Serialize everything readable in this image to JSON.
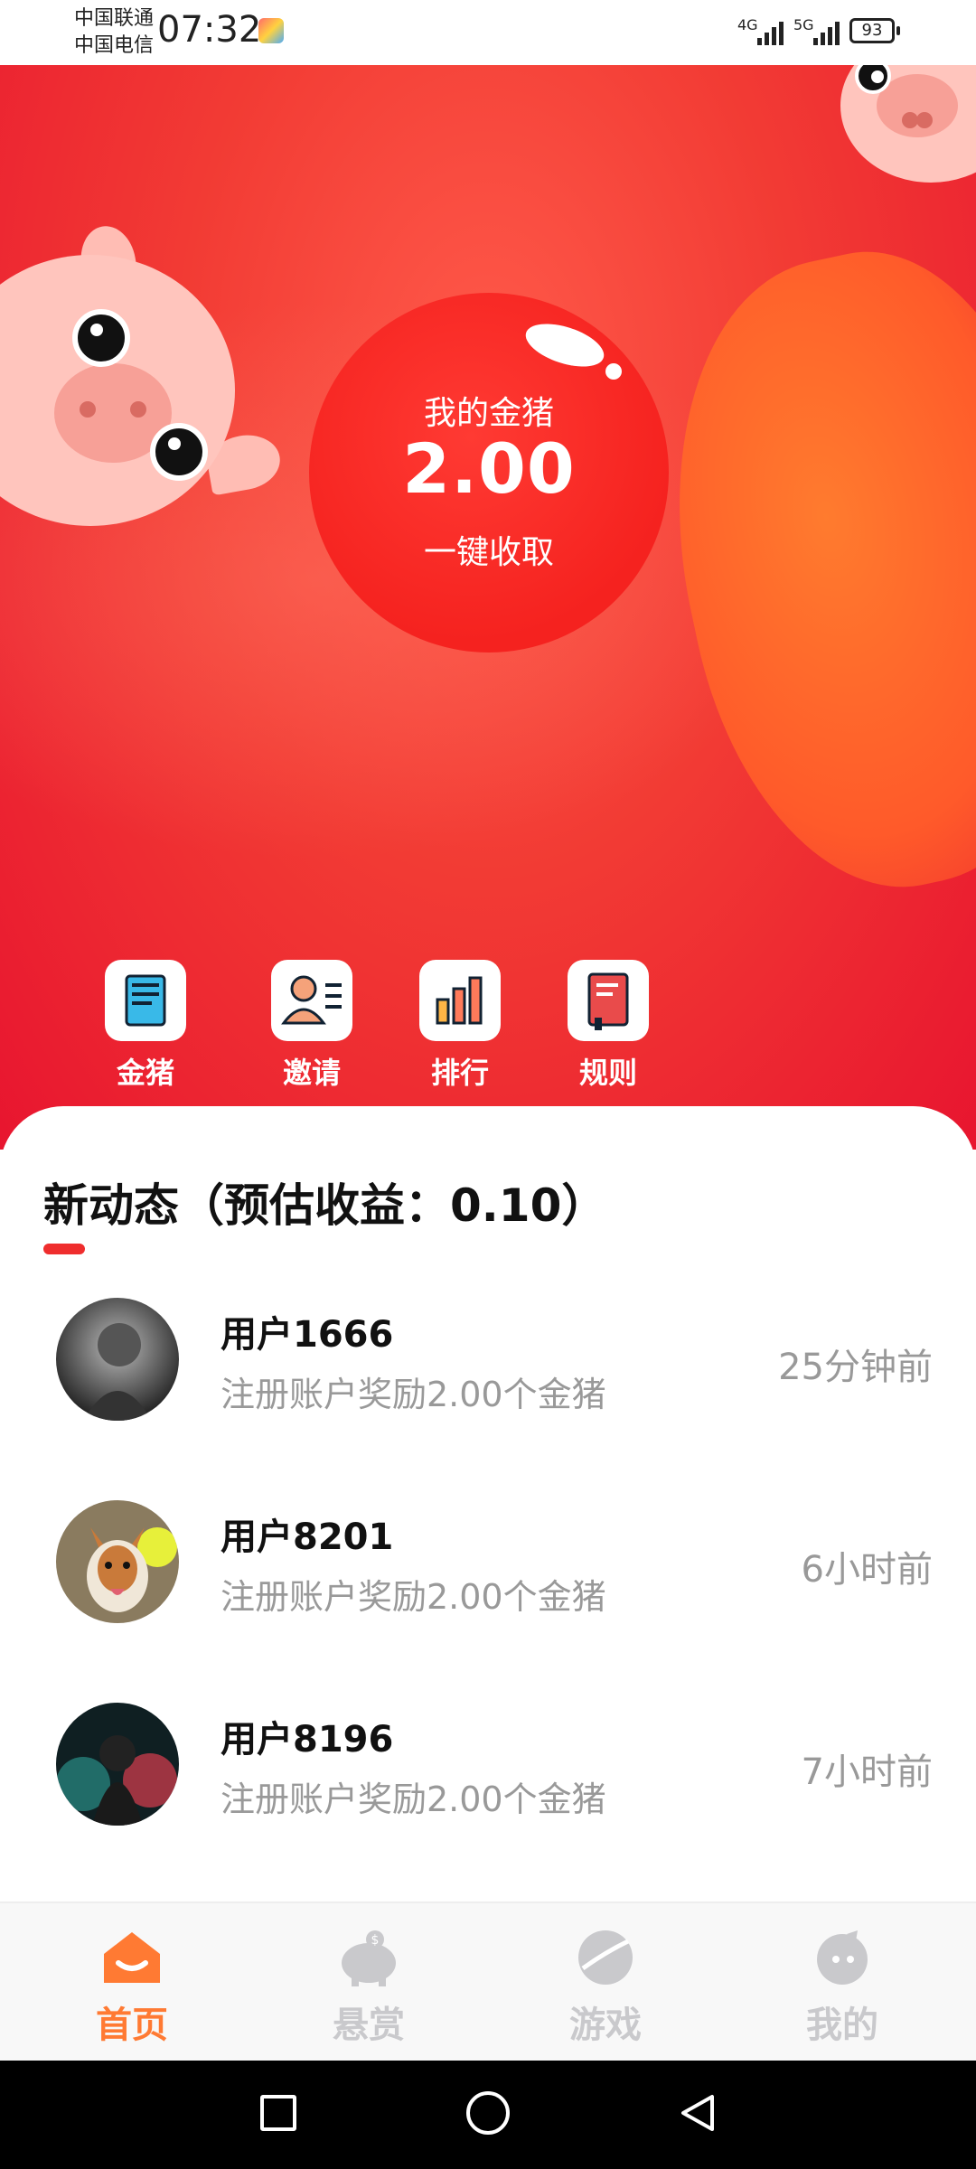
{
  "status_bar": {
    "carrier_1": "中国联通",
    "carrier_2": "中国电信",
    "time": "07:32",
    "network_1": "4G",
    "network_2": "5G",
    "battery": "93"
  },
  "hero": {
    "coin_label": "我的金猪",
    "coin_value": "2.00",
    "coin_action": "一键收取"
  },
  "quick_menu": [
    {
      "label": "金猪",
      "icon": "ledger-icon"
    },
    {
      "label": "邀请",
      "icon": "invite-user-icon"
    },
    {
      "label": "排行",
      "icon": "bar-chart-icon"
    },
    {
      "label": "规则",
      "icon": "rule-book-icon"
    }
  ],
  "feed": {
    "title": "新动态（预估收益：0.10）",
    "items": [
      {
        "user": "用户1666",
        "desc": "注册账户奖励2.00个金猪",
        "time": "25分钟前"
      },
      {
        "user": "用户8201",
        "desc": "注册账户奖励2.00个金猪",
        "time": "6小时前"
      },
      {
        "user": "用户8196",
        "desc": "注册账户奖励2.00个金猪",
        "time": "7小时前"
      }
    ]
  },
  "tabbar": [
    {
      "label": "首页",
      "icon": "home-icon",
      "active": true
    },
    {
      "label": "悬赏",
      "icon": "piggy-bank-icon",
      "active": false
    },
    {
      "label": "游戏",
      "icon": "game-ball-icon",
      "active": false
    },
    {
      "label": "我的",
      "icon": "profile-icon",
      "active": false
    }
  ],
  "colors": {
    "accent_red": "#ef2d2d",
    "active_tab": "#ff7a33",
    "muted_text": "#999999"
  }
}
